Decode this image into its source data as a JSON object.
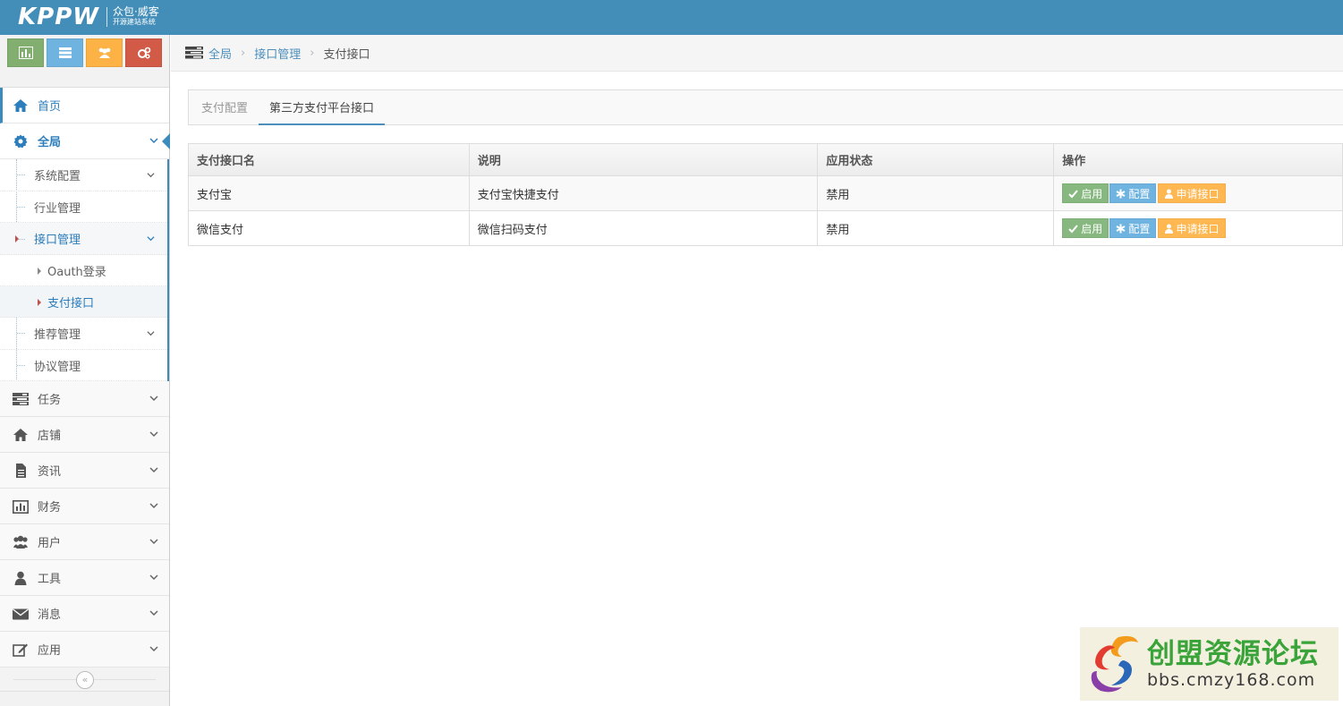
{
  "brand": {
    "logo_main": "KPPW",
    "logo_sub1": "众包·威客",
    "logo_sub2": "开源建站系统"
  },
  "shortcuts": [
    {
      "name": "chart-shortcut",
      "color": "#82af6f"
    },
    {
      "name": "list-shortcut",
      "color": "#6fb3e0"
    },
    {
      "name": "users-shortcut",
      "color": "#fcb244"
    },
    {
      "name": "settings-shortcut",
      "color": "#d15b47"
    }
  ],
  "sidebar": {
    "home": "首页",
    "global": "全局",
    "sub": {
      "system_config": "系统配置",
      "industry": "行业管理",
      "interface": "接口管理",
      "oauth": "Oauth登录",
      "payment": "支付接口",
      "recommend": "推荐管理",
      "protocol": "协议管理"
    },
    "task": "任务",
    "shop": "店铺",
    "news": "资讯",
    "finance": "财务",
    "user": "用户",
    "tools": "工具",
    "message": "消息",
    "apps": "应用",
    "collapse_icon": "«"
  },
  "breadcrumb": {
    "home": "全局",
    "parent": "接口管理",
    "current": "支付接口",
    "sep": "›"
  },
  "tabs": {
    "config": "支付配置",
    "third_party": "第三方支付平台接口"
  },
  "table": {
    "headers": [
      "支付接口名",
      "说明",
      "应用状态",
      "操作"
    ],
    "rows": [
      {
        "name": "支付宝",
        "desc": "支付宝快捷支付",
        "status": "禁用"
      },
      {
        "name": "微信支付",
        "desc": "微信扫码支付",
        "status": "禁用"
      }
    ],
    "actions": {
      "enable": "启用",
      "configure": "配置",
      "apply": "申请接口"
    }
  },
  "watermark": {
    "title": "创盟资源论坛",
    "url": "bbs.cmzy168.com"
  }
}
